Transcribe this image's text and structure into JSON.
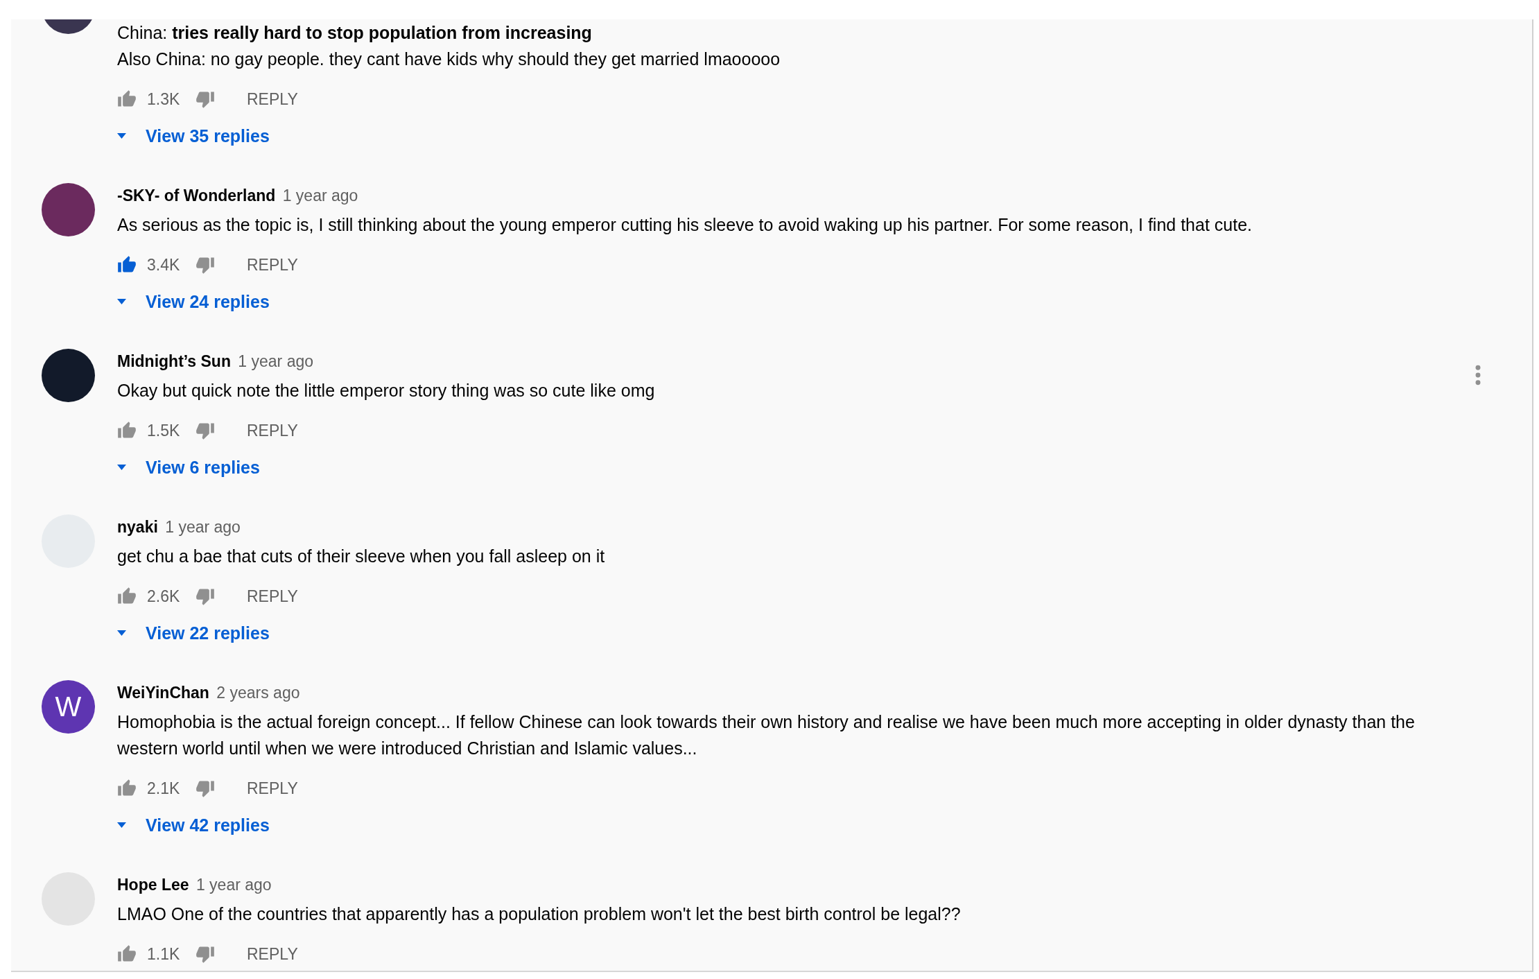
{
  "comments": [
    {
      "avatar": {
        "kind": "photo",
        "color": "#3a3550"
      },
      "text": [
        "China: **tries really hard to stop population from increasing**",
        "Also China: no gay people. they cant have kids why should they get married lmaooooo"
      ],
      "liked": false,
      "likes": "1.3K",
      "reply": "REPLY",
      "replies": "View 35 replies",
      "menu_visible": false
    },
    {
      "avatar": {
        "kind": "photo",
        "color": "#6b2a5e"
      },
      "author": "-SKY- of Wonderland",
      "time": "1 year ago",
      "text": [
        "As serious as the topic is, I still thinking about the young emperor cutting his sleeve to avoid waking up his partner. For some reason, I find that cute."
      ],
      "liked": true,
      "likes": "3.4K",
      "reply": "REPLY",
      "replies": "View 24 replies",
      "menu_visible": false
    },
    {
      "avatar": {
        "kind": "photo",
        "color": "#121a2a"
      },
      "author": "Midnight’s Sun",
      "time": "1 year ago",
      "text": [
        "Okay but quick note the little emperor story thing was so cute like omg"
      ],
      "liked": false,
      "likes": "1.5K",
      "reply": "REPLY",
      "replies": "View 6 replies",
      "menu_visible": true
    },
    {
      "avatar": {
        "kind": "photo",
        "color": "#e8ecef"
      },
      "author": "nyaki",
      "time": "1 year ago",
      "text": [
        "get chu a bae that cuts of their sleeve when you fall asleep on it"
      ],
      "liked": false,
      "likes": "2.6K",
      "reply": "REPLY",
      "replies": "View 22 replies",
      "menu_visible": false
    },
    {
      "avatar": {
        "kind": "letter",
        "letter": "W",
        "color": "#5e35b1"
      },
      "author": "WeiYinChan",
      "time": "2 years ago",
      "text": [
        "Homophobia is the actual foreign concept... If fellow Chinese can look towards their own history and realise we have been much more accepting in older dynasty than the western world until when we were introduced Christian and Islamic values..."
      ],
      "liked": false,
      "likes": "2.1K",
      "reply": "REPLY",
      "replies": "View 42 replies",
      "menu_visible": false
    },
    {
      "avatar": {
        "kind": "photo",
        "color": "#e4e4e4"
      },
      "author": "Hope Lee",
      "time": "1 year ago",
      "text": [
        "LMAO One of the countries that apparently has a population problem won't let the best birth control be legal??"
      ],
      "liked": false,
      "likes": "1.1K",
      "reply": "REPLY",
      "menu_visible": false
    }
  ]
}
